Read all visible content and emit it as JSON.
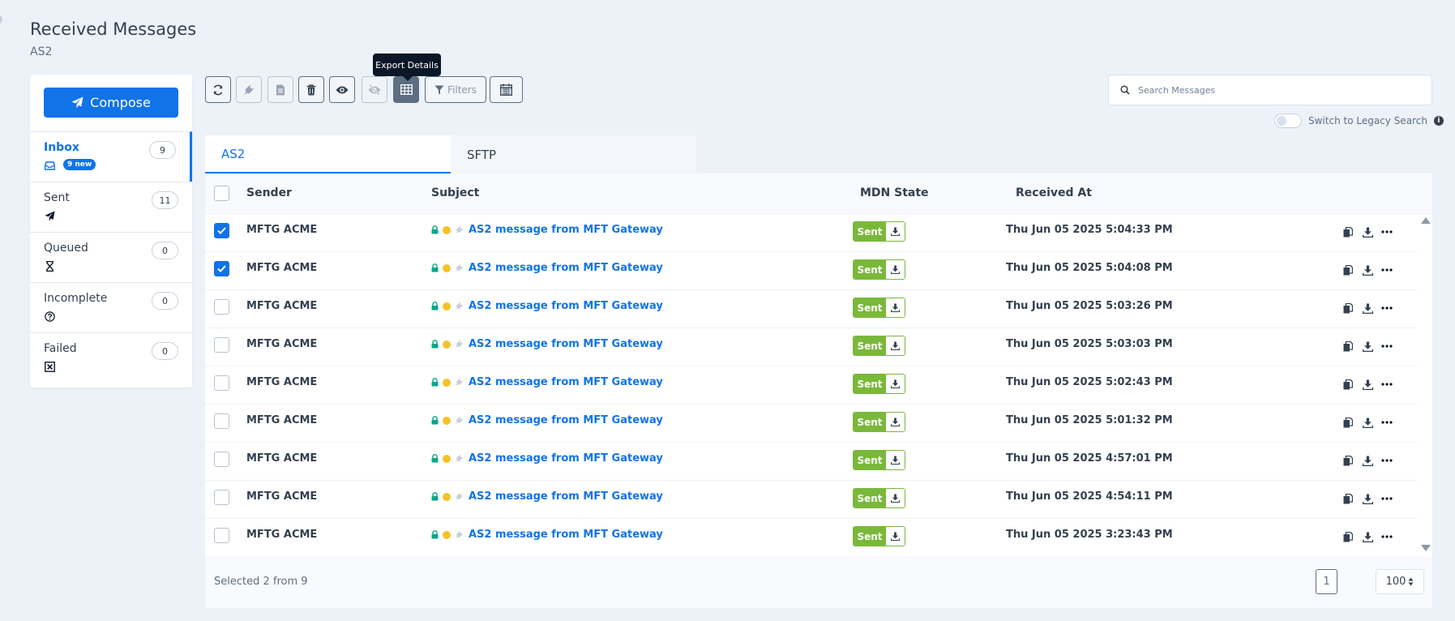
{
  "page": {
    "title": "Received Messages",
    "subtitle": "AS2"
  },
  "sidebar": {
    "compose_label": "Compose",
    "folders": [
      {
        "label": "Inbox",
        "count": "9",
        "icon": "inbox-icon",
        "badge": "9 new",
        "active": true
      },
      {
        "label": "Sent",
        "count": "11",
        "icon": "paper-plane-icon",
        "active": false
      },
      {
        "label": "Queued",
        "count": "0",
        "icon": "hourglass-icon",
        "active": false
      },
      {
        "label": "Incomplete",
        "count": "0",
        "icon": "question-circle-icon",
        "active": false
      },
      {
        "label": "Failed",
        "count": "0",
        "icon": "x-square-icon",
        "active": false
      }
    ]
  },
  "toolbar": {
    "buttons": [
      "refresh-icon",
      "unplug-icon",
      "document-icon",
      "trash-icon",
      "eye-icon",
      "eye-slash-icon",
      "table-icon"
    ],
    "filters_label": "Filters",
    "calendar": "calendar-icon",
    "tooltip": "Export Details"
  },
  "search": {
    "placeholder": "Search Messages",
    "legacy_label": "Switch to Legacy Search",
    "legacy_enabled": false
  },
  "tabs": [
    {
      "label": "AS2",
      "active": true
    },
    {
      "label": "SFTP",
      "active": false
    }
  ],
  "table": {
    "headers": {
      "sender": "Sender",
      "subject": "Subject",
      "mdn": "MDN State",
      "received": "Received At"
    },
    "rows": [
      {
        "checked": true,
        "sender": "MFTG ACME",
        "subject": "AS2 message from MFT Gateway",
        "mdn": "Sent",
        "received": "Thu Jun 05 2025 5:04:33 PM"
      },
      {
        "checked": true,
        "sender": "MFTG ACME",
        "subject": "AS2 message from MFT Gateway",
        "mdn": "Sent",
        "received": "Thu Jun 05 2025 5:04:08 PM"
      },
      {
        "checked": false,
        "sender": "MFTG ACME",
        "subject": "AS2 message from MFT Gateway",
        "mdn": "Sent",
        "received": "Thu Jun 05 2025 5:03:26 PM"
      },
      {
        "checked": false,
        "sender": "MFTG ACME",
        "subject": "AS2 message from MFT Gateway",
        "mdn": "Sent",
        "received": "Thu Jun 05 2025 5:03:03 PM"
      },
      {
        "checked": false,
        "sender": "MFTG ACME",
        "subject": "AS2 message from MFT Gateway",
        "mdn": "Sent",
        "received": "Thu Jun 05 2025 5:02:43 PM"
      },
      {
        "checked": false,
        "sender": "MFTG ACME",
        "subject": "AS2 message from MFT Gateway",
        "mdn": "Sent",
        "received": "Thu Jun 05 2025 5:01:32 PM"
      },
      {
        "checked": false,
        "sender": "MFTG ACME",
        "subject": "AS2 message from MFT Gateway",
        "mdn": "Sent",
        "received": "Thu Jun 05 2025 4:57:01 PM"
      },
      {
        "checked": false,
        "sender": "MFTG ACME",
        "subject": "AS2 message from MFT Gateway",
        "mdn": "Sent",
        "received": "Thu Jun 05 2025 4:54:11 PM"
      },
      {
        "checked": false,
        "sender": "MFTG ACME",
        "subject": "AS2 message from MFT Gateway",
        "mdn": "Sent",
        "received": "Thu Jun 05 2025 3:23:43 PM"
      }
    ]
  },
  "footer": {
    "selected_text": "Selected 2 from 9",
    "current_page": "1",
    "per_page": "100"
  },
  "colors": {
    "accent": "#1173e8",
    "mdn_sent": "#7ab83a",
    "lock": "#00a88a",
    "status_dot": "#f5c225"
  }
}
